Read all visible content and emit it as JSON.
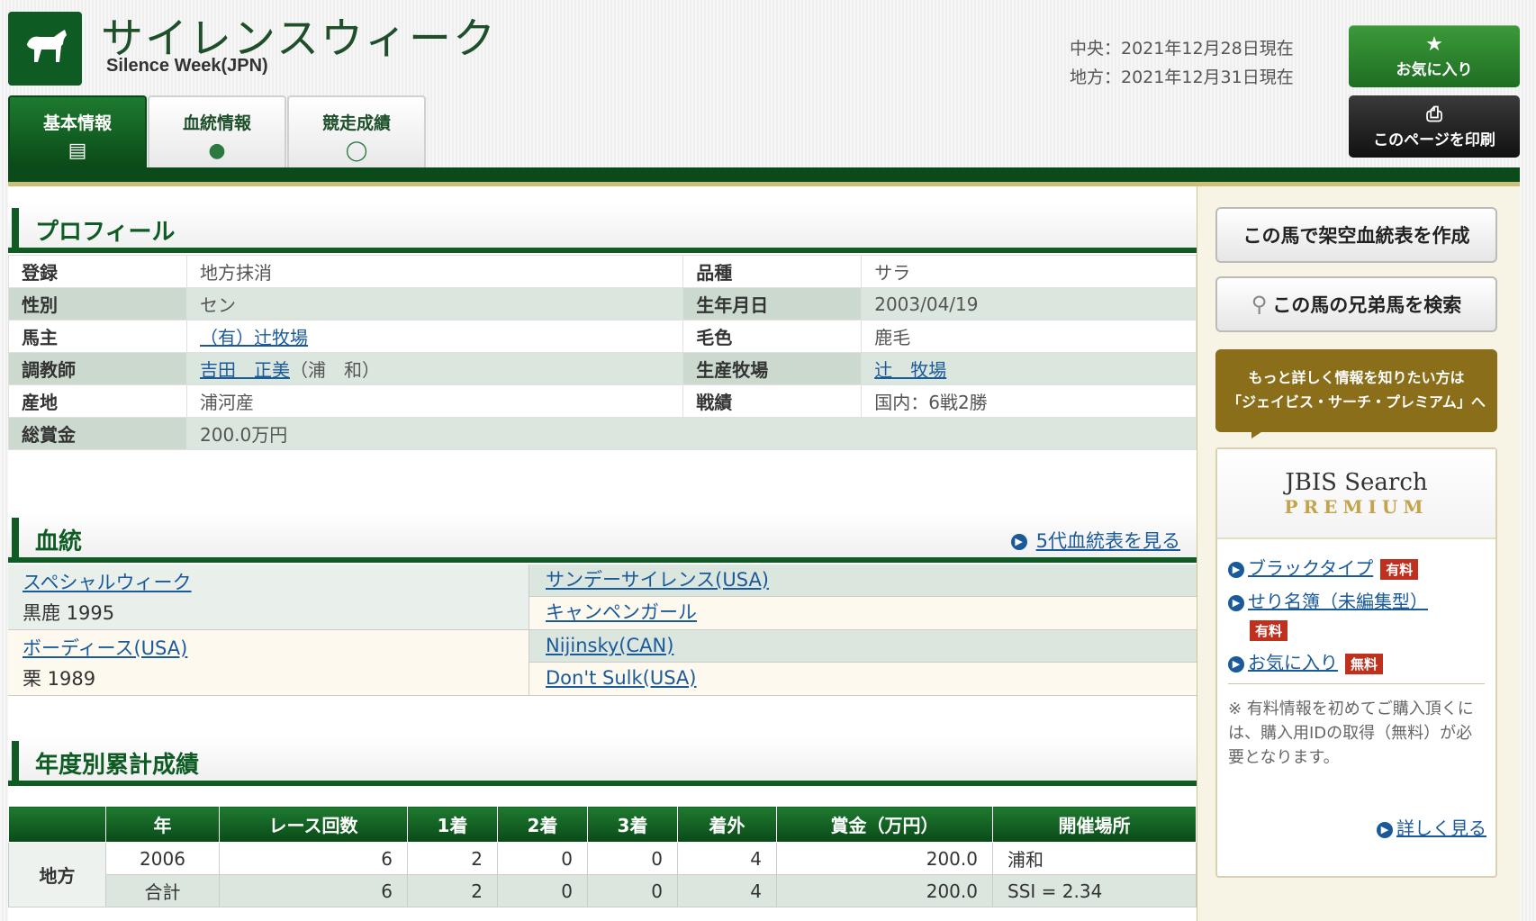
{
  "header": {
    "title_jp": "サイレンスウィーク",
    "title_en": "Silence Week(JPN)",
    "date_central": "中央：2021年12月28日現在",
    "date_local": "地方：2021年12月31日現在",
    "fav_button": "お気に入り",
    "print_button": "このページを印刷"
  },
  "tabs": [
    {
      "label": "基本情報",
      "active": true
    },
    {
      "label": "血統情報",
      "active": false
    },
    {
      "label": "競走成績",
      "active": false
    }
  ],
  "profile": {
    "heading": "プロフィール",
    "rows": [
      {
        "k1": "登録",
        "v1": "地方抹消",
        "k2": "品種",
        "v2": "サラ"
      },
      {
        "k1": "性別",
        "v1": "セン",
        "k2": "生年月日",
        "v2": "2003/04/19"
      },
      {
        "k1": "馬主",
        "v1": "（有）辻牧場",
        "k2": "毛色",
        "v2": "鹿毛"
      },
      {
        "k1": "調教師",
        "v1": "吉田　正美",
        "v1b": "（浦　和）",
        "k2": "生産牧場",
        "v2": "辻　牧場"
      },
      {
        "k1": "産地",
        "v1": "浦河産",
        "k2": "戦績",
        "v2": "国内：6戦2勝"
      },
      {
        "k1": "総賞金",
        "v1": "200.0万円"
      }
    ]
  },
  "pedigree": {
    "heading": "血統",
    "link": "5代血統表を見る",
    "sire": {
      "name": "スペシャルウィーク",
      "info": "黒鹿 1995"
    },
    "dam": {
      "name": "ボーディース(USA)",
      "info": "栗 1989"
    },
    "sire_sire": "サンデーサイレンス(USA)",
    "sire_dam": "キャンペンガール",
    "dam_sire": "Nijinsky(CAN)",
    "dam_dam": "Don't Sulk(USA)"
  },
  "stats": {
    "heading": "年度別累計成績",
    "columns": [
      "年",
      "レース回数",
      "1着",
      "2着",
      "3着",
      "着外",
      "賞金（万円）",
      "開催場所"
    ],
    "category": "地方",
    "rows": [
      {
        "year": "2006",
        "races": "6",
        "first": "2",
        "second": "0",
        "third": "0",
        "out": "4",
        "prize": "200.0",
        "venue": "浦和"
      },
      {
        "year": "合計",
        "races": "6",
        "first": "2",
        "second": "0",
        "third": "0",
        "out": "4",
        "prize": "200.0",
        "venue": "SSI = 2.34"
      }
    ]
  },
  "sidebar": {
    "btn_pedigree": "この馬で架空血統表を作成",
    "btn_siblings": "この馬の兄弟馬を検索",
    "promo_line1": "もっと詳しく情報を知りたい方は",
    "promo_line2": "「ジェイビス・サーチ・プレミアム」へ",
    "logo_l1": "JBIS Search",
    "logo_l2": "PREMIUM",
    "links": [
      {
        "label": "ブラックタイプ",
        "badge": "有料"
      },
      {
        "label": "せり名簿（未編集型）",
        "badge": "有料"
      },
      {
        "label": "お気に入り",
        "badge": "無料"
      }
    ],
    "note": "※ 有料情報を初めてご購入頂くには、購入用IDの取得（無料）が必要となります。",
    "more": "詳しく見る"
  }
}
